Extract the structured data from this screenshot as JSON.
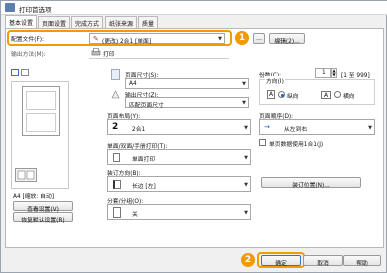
{
  "window": {
    "title": "打印首选项"
  },
  "tabs": [
    "基本设置",
    "页面设置",
    "完成方式",
    "纸张来源",
    "质量"
  ],
  "profile": {
    "label": "配置文件(F):",
    "value": "(更改) 2合1 [单面]",
    "add_label": "添加(1)...",
    "edit_label": "编辑(2)..."
  },
  "output_method": {
    "label": "输出方法(M):",
    "value": "打印"
  },
  "preview": {
    "caption": "A4 [缩放: 自动]",
    "view_settings": "查看设置(V)",
    "restore_defaults": "恢复默认设置(R)"
  },
  "page_size": {
    "label": "页面尺寸(S):",
    "value": "A4"
  },
  "output_size": {
    "label": "输出尺寸(Z):",
    "value": "匹配页面尺寸"
  },
  "copies": {
    "label": "份数(C):",
    "value": "1",
    "range": "[1 至 999]"
  },
  "orientation": {
    "label": "方向(I)",
    "portrait": "纵向",
    "landscape": "横向",
    "selected": "纵向"
  },
  "page_layout": {
    "label": "页面布局(Y):",
    "value": "2合1"
  },
  "page_order": {
    "label": "页面顺序(D):",
    "value": "从左到右"
  },
  "print_style": {
    "label": "单面/双面/手册打印(T):",
    "value": "单面打印"
  },
  "binding_direction": {
    "label": "装订方向(B):",
    "value": "长边 [左]"
  },
  "binding_position": {
    "label": "装订位置(N)..."
  },
  "collate": {
    "label": "分套/分组(O):",
    "value": "关"
  },
  "single_page_checkbox": {
    "label": "单页数据使用1合1(J)",
    "checked": false
  },
  "footer": {
    "ok": "确定",
    "cancel": "取消",
    "help": "帮助"
  },
  "callouts": [
    "1",
    "2"
  ],
  "colors": {
    "accent": "#f29a00",
    "selection": "#1a5fd0"
  }
}
